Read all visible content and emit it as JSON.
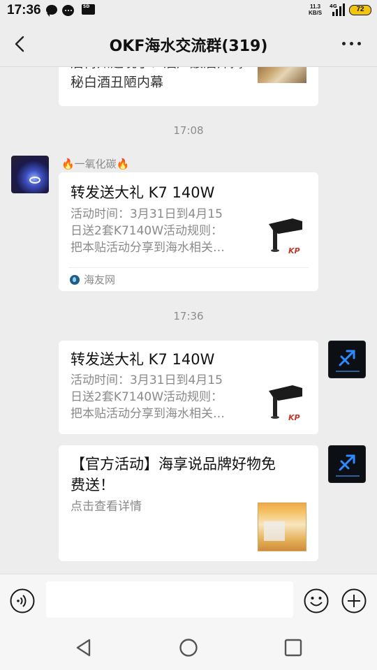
{
  "status_bar": {
    "time": "17:36",
    "net_speed_value": "11.3",
    "net_speed_unit": "KB/S",
    "network_type": "4G",
    "sd_label": "SD",
    "battery": "72"
  },
  "header": {
    "title": "OKF海水交流群(319)"
  },
  "messages": {
    "top_card": {
      "line1": "后悔知道晚了？酒厂酿酒师揭",
      "line2": "秘白酒丑陋内幕"
    },
    "time1": "17:08",
    "msg1": {
      "sender": "🔥一氧化碳🔥",
      "title": "转发送大礼 K7 140W",
      "desc_line1": "活动时间：3月31日到4月15",
      "desc_line2": "日送2套K7140W活动规则：",
      "desc_line3": "把本贴活动分享到海水相关…",
      "source": "海友网"
    },
    "time2": "17:36",
    "msg2": {
      "title": "转发送大礼 K7 140W",
      "desc_line1": "活动时间：3月31日到4月15",
      "desc_line2": "日送2套K7140W活动规则：",
      "desc_line3": "把本贴活动分享到海水相关…"
    },
    "msg3": {
      "title_line1": "【官方活动】海享说品牌好物免",
      "title_line2": "费送！",
      "desc": "点击查看详情"
    }
  },
  "input": {
    "value": ""
  },
  "icons": {
    "back": "back-arrow-icon",
    "more": "more-dots-icon",
    "voice": "voice-icon",
    "emoji": "emoji-icon",
    "plus": "plus-icon",
    "nav_back": "nav-back-icon",
    "nav_home": "nav-home-icon",
    "nav_recent": "nav-recent-icon"
  },
  "colors": {
    "background": "#ededed",
    "bubble": "#ffffff",
    "battery": "#f1c40f"
  }
}
